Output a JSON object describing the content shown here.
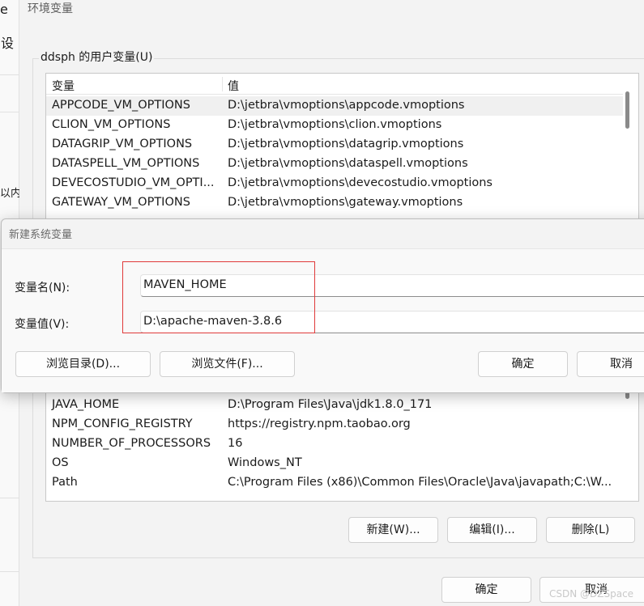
{
  "background_window": {
    "fragments": [
      "e",
      "设",
      "以内"
    ]
  },
  "env_window": {
    "title": "环境变量",
    "user_vars_label": "ddsph 的用户变量(U)",
    "columns": {
      "name": "变量",
      "value": "值"
    },
    "top_rows": [
      {
        "name": "APPCODE_VM_OPTIONS",
        "value": "D:\\jetbra\\vmoptions\\appcode.vmoptions"
      },
      {
        "name": "CLION_VM_OPTIONS",
        "value": "D:\\jetbra\\vmoptions\\clion.vmoptions"
      },
      {
        "name": "DATAGRIP_VM_OPTIONS",
        "value": "D:\\jetbra\\vmoptions\\datagrip.vmoptions"
      },
      {
        "name": "DATASPELL_VM_OPTIONS",
        "value": "D:\\jetbra\\vmoptions\\dataspell.vmoptions"
      },
      {
        "name": "DEVECOSTUDIO_VM_OPTI...",
        "value": "D:\\jetbra\\vmoptions\\devecostudio.vmoptions"
      },
      {
        "name": "GATEWAY_VM_OPTIONS",
        "value": "D:\\jetbra\\vmoptions\\gateway.vmoptions"
      }
    ],
    "bottom_rows": [
      {
        "name": "JAVA_HOME",
        "value": "D:\\Program Files\\Java\\jdk1.8.0_171"
      },
      {
        "name": "NPM_CONFIG_REGISTRY",
        "value": "https://registry.npm.taobao.org"
      },
      {
        "name": "NUMBER_OF_PROCESSORS",
        "value": "16"
      },
      {
        "name": "OS",
        "value": "Windows_NT"
      },
      {
        "name": "Path",
        "value": "C:\\Program Files (x86)\\Common Files\\Oracle\\Java\\javapath;C:\\W..."
      }
    ],
    "buttons": {
      "new": "新建(W)...",
      "edit": "编辑(I)...",
      "delete": "删除(L)",
      "ok": "确定",
      "cancel": "取消"
    }
  },
  "dialog": {
    "title": "新建系统变量",
    "name_label": "变量名(N):",
    "name_value": "MAVEN_HOME",
    "value_label": "变量值(V):",
    "value_value": "D:\\apache-maven-3.8.6",
    "buttons": {
      "browse_dir": "浏览目录(D)...",
      "browse_file": "浏览文件(F)...",
      "ok": "确定",
      "cancel": "取消"
    }
  },
  "watermark": "CSDN @DZSpace",
  "colors": {
    "highlight_box": "#e03a3a",
    "selected_row": "#f0f0f0",
    "window_bg": "#f3f3f3"
  }
}
